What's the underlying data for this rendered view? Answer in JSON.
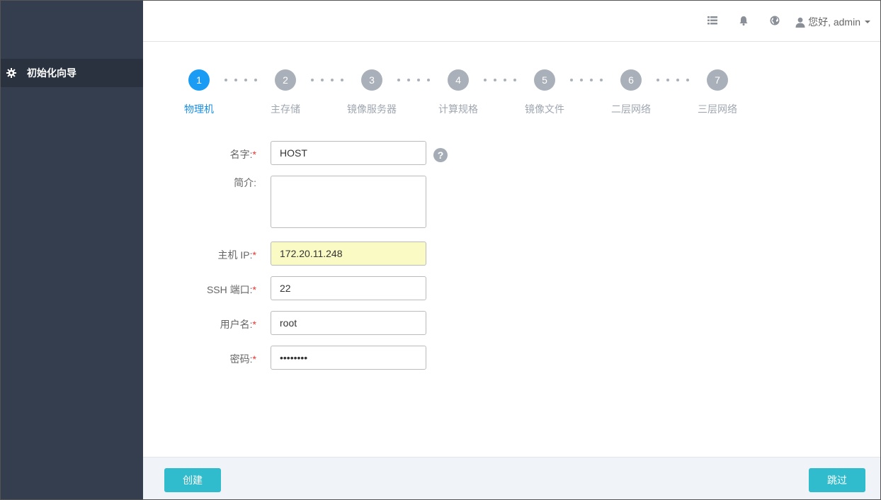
{
  "sidebar": {
    "items": [
      {
        "label": "初始化向导",
        "icon": "gear-icon"
      }
    ]
  },
  "topbar": {
    "icons": [
      "list-icon",
      "bell-icon",
      "globe-icon"
    ],
    "user_label": "您好, admin",
    "user_icon": "user-icon"
  },
  "steps": [
    {
      "num": "1",
      "label": "物理机",
      "active": true
    },
    {
      "num": "2",
      "label": "主存储",
      "active": false
    },
    {
      "num": "3",
      "label": "镜像服务器",
      "active": false
    },
    {
      "num": "4",
      "label": "计算规格",
      "active": false
    },
    {
      "num": "5",
      "label": "镜像文件",
      "active": false
    },
    {
      "num": "6",
      "label": "二层网络",
      "active": false
    },
    {
      "num": "7",
      "label": "三层网络",
      "active": false
    }
  ],
  "form": {
    "name": {
      "label": "名字:",
      "required": "*",
      "value": "HOST"
    },
    "description": {
      "label": "简介:",
      "value": ""
    },
    "host_ip": {
      "label": "主机 IP:",
      "required": "*",
      "value": "172.20.11.248"
    },
    "ssh_port": {
      "label": "SSH 端口:",
      "required": "*",
      "value": "22"
    },
    "username": {
      "label": "用户名:",
      "required": "*",
      "value": "root"
    },
    "password": {
      "label": "密码:",
      "required": "*",
      "value": "••••••••"
    },
    "help_icon": "question-icon"
  },
  "footer": {
    "create_label": "创建",
    "skip_label": "跳过"
  },
  "colors": {
    "sidebar_bg": "#343e4e",
    "active_step": "#1a9cf5",
    "inactive_step": "#a9b0ba",
    "button": "#30bccc",
    "required": "#e33333"
  }
}
